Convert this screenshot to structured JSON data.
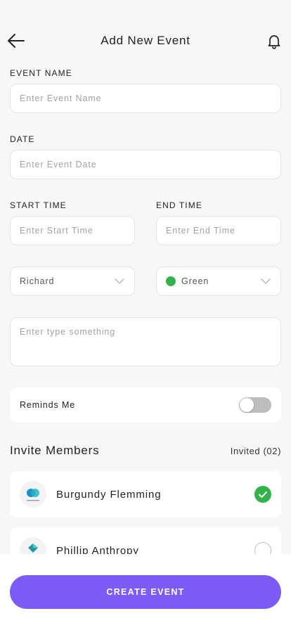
{
  "header": {
    "title": "Add New Event",
    "back_icon": "arrow-left-icon",
    "notification_icon": "bell-icon"
  },
  "form": {
    "event_name": {
      "label": "EVENT NAME",
      "placeholder": "Enter Event Name",
      "value": ""
    },
    "date": {
      "label": "DATE",
      "placeholder": "Enter Event Date",
      "value": ""
    },
    "start_time": {
      "label": "START TIME",
      "placeholder": "Enter Start Time",
      "value": ""
    },
    "end_time": {
      "label": "END TIME",
      "placeholder": "Enter End Time",
      "value": ""
    },
    "member_select": {
      "value": "Richard",
      "icon": "chevron-down-icon"
    },
    "color_select": {
      "value": "Green",
      "color": "#34b24a",
      "icon": "chevron-down-icon"
    },
    "notes": {
      "placeholder": "Enter type something",
      "value": ""
    }
  },
  "reminder": {
    "label": "Reminds Me",
    "enabled": false
  },
  "invite": {
    "title": "Invite Members",
    "invited_label": "Invited (02)",
    "members": [
      {
        "name": "Burgundy Flemming",
        "selected": true,
        "check_color": "#34b24a"
      },
      {
        "name": "Phillip Anthropy",
        "selected": false
      }
    ]
  },
  "cta": {
    "label": "CREATE EVENT",
    "color": "#7b5cf7"
  }
}
